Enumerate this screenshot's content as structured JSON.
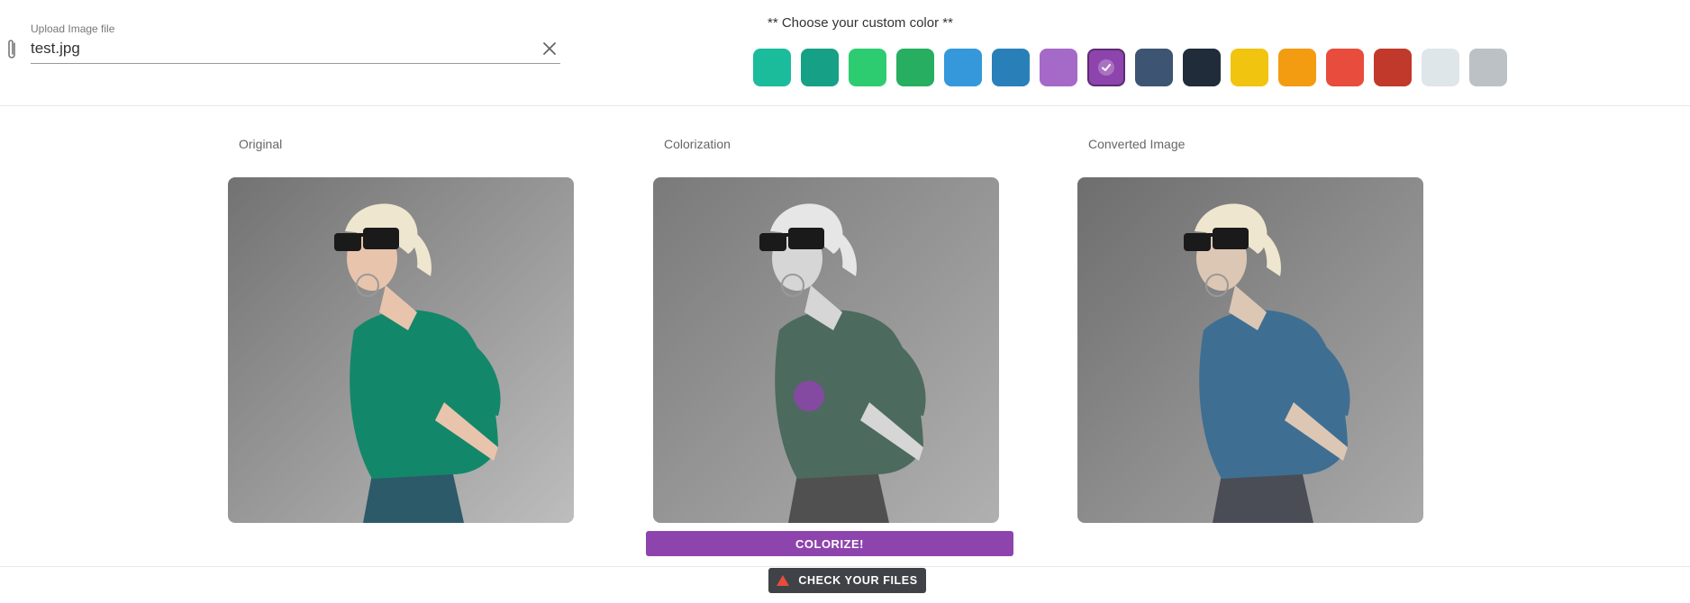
{
  "upload": {
    "label": "Upload Image file",
    "value": "test.jpg",
    "attach_icon": "paperclip-icon",
    "clear_icon": "close-icon"
  },
  "palette": {
    "heading": "** Choose your custom color **",
    "selected_index": 7,
    "colors": [
      "#1abc9c",
      "#16a085",
      "#2ecc71",
      "#27ae60",
      "#3498db",
      "#2980b9",
      "#a569c8",
      "#8e44ad",
      "#3d5472",
      "#202c3a",
      "#f1c40f",
      "#f39c12",
      "#e74c3c",
      "#c0392b",
      "#dfe6e9",
      "#bcc1c6"
    ]
  },
  "panels": {
    "original": {
      "label": "Original",
      "sweater_color": "#13876a"
    },
    "colorization": {
      "label": "Colorization",
      "sweater_color": "#4d6a5e",
      "marker_color": "#8e44ad"
    },
    "converted": {
      "label": "Converted Image",
      "sweater_color": "#3e6f92"
    }
  },
  "buttons": {
    "colorize": "COLORIZE!",
    "check_files": "CHECK YOUR FILES",
    "check_files_icon": "warning-icon"
  }
}
